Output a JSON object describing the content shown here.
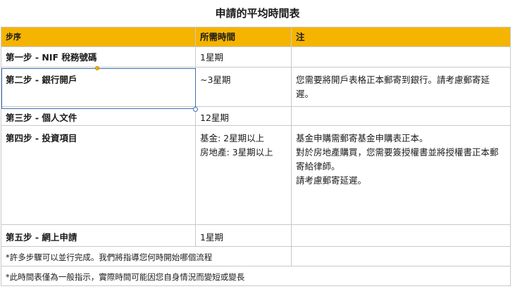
{
  "page": {
    "title": "申請的平均時間表"
  },
  "table": {
    "headers": [
      "步序",
      "所需時間",
      "注"
    ],
    "rows": [
      {
        "step": "第一步 - NIF 稅務號碼",
        "time": [
          "1星期"
        ],
        "notes": []
      },
      {
        "step": "第二步 - 銀行開戶",
        "time": [
          "~3星期"
        ],
        "notes": [
          "您需要將開戶表格正本郵寄到銀行。請考慮郵寄延遲。"
        ]
      },
      {
        "step": "第三步 - 個人文件",
        "time": [
          "12星期"
        ],
        "notes": []
      },
      {
        "step": "第四步 - 投資項目",
        "time": [
          "基金: 2星期以上",
          "房地產: 3星期以上"
        ],
        "notes": [
          "基金申購需郵寄基金申購表正本。",
          "對於房地產購買，您需要簽授權書並將授權書正本郵寄給律師。",
          "請考慮郵寄延遲。"
        ]
      },
      {
        "step": "第五步 - 網上申請",
        "time": [
          "1星期"
        ],
        "notes": []
      }
    ],
    "footnotes": [
      "*許多步驟可以並行完成。我們將指導您何時開始哪個流程",
      "*此時間表僅為一般指示，實際時間可能因您自身情況而變短或變長"
    ]
  },
  "colors": {
    "header_bg": "#f5b400",
    "selection": "#3c6fb3"
  }
}
